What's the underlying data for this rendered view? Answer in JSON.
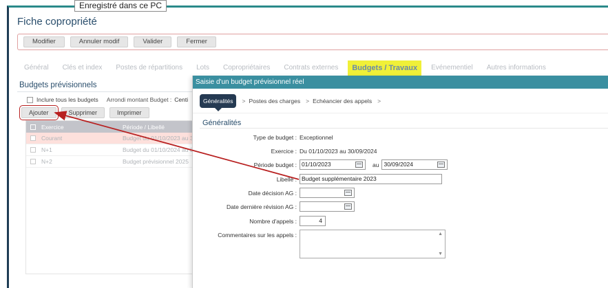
{
  "tooltip": "Enregistré dans ce PC",
  "page_title": "Fiche copropriété",
  "toolbar": {
    "modifier": "Modifier",
    "annuler": "Annuler modif",
    "valider": "Valider",
    "fermer": "Fermer"
  },
  "tabs": [
    {
      "label": "Général"
    },
    {
      "label": "Clés et index"
    },
    {
      "label": "Postes de répartitions"
    },
    {
      "label": "Lots"
    },
    {
      "label": "Copropriétaires"
    },
    {
      "label": "Contrats externes"
    },
    {
      "label": "Budgets / Travaux",
      "active": true
    },
    {
      "label": "Evénementiel"
    },
    {
      "label": "Autres informations"
    }
  ],
  "left": {
    "section_title": "Budgets prévisionnels",
    "include_label": "Inclure tous les budgets",
    "arrondi_label": "Arrondi montant Budget :",
    "arrondi_value": "Centi",
    "buttons": {
      "ajouter": "Ajouter",
      "supprimer": "Supprimer",
      "imprimer": "Imprimer"
    },
    "grid": {
      "headers": [
        "Exercice",
        "Période / Libellé"
      ],
      "rows": [
        {
          "exercice": "Courant",
          "libelle": "Budget du 01/10/2023 au 30/0"
        },
        {
          "exercice": "N+1",
          "libelle": "Budget du 01/10/2024 au 30/0"
        },
        {
          "exercice": "N+2",
          "libelle": "Budget prévisionnel 2025"
        }
      ]
    }
  },
  "dialog": {
    "title": "Saisie d'un budget prévisionnel réel",
    "crumbs": [
      "Généralités",
      "Postes des charges",
      "Echéancier des appels"
    ],
    "section": "Généralités",
    "fields": {
      "type_label": "Type de budget :",
      "type_value": "Exceptionnel",
      "exercice_label": "Exercice :",
      "exercice_value": "Du 01/10/2023 au 30/09/2024",
      "periode_label": "Période budget :",
      "periode_start": "01/10/2023",
      "periode_au": "au",
      "periode_end": "30/09/2024",
      "libelle_label": "Libellé :",
      "libelle_value": "Budget supplémentaire 2023",
      "date_decision_label": "Date décision AG :",
      "date_revision_label": "Date dernière révision AG :",
      "nb_appels_label": "Nombre d'appels :",
      "nb_appels_value": "4",
      "commentaires_label": "Commentaires sur les appels :"
    }
  },
  "colors": {
    "accent": "#3a8fa0",
    "highlight": "#f0f038",
    "annotation": "#b82020"
  }
}
